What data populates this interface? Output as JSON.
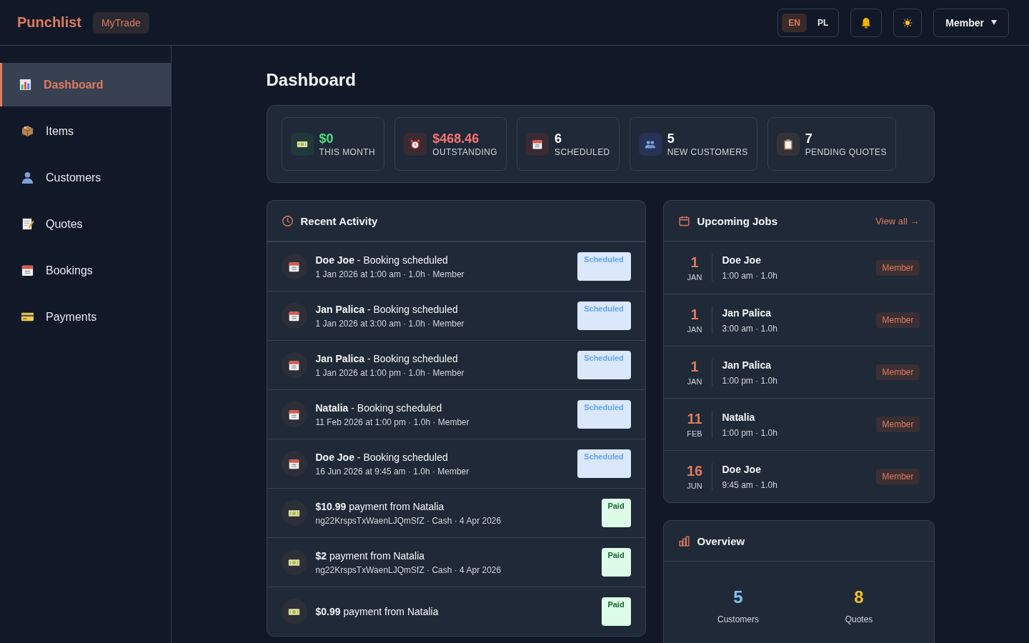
{
  "brand": {
    "name": "Punchlist",
    "tag": "MyTrade"
  },
  "languages": [
    {
      "label": "EN",
      "selected": true
    },
    {
      "label": "PL",
      "selected": false
    }
  ],
  "user_menu": {
    "label": "Member"
  },
  "sidebar": {
    "items": [
      {
        "label": "Dashboard",
        "selected": true
      },
      {
        "label": "Items",
        "selected": false
      },
      {
        "label": "Customers",
        "selected": false
      },
      {
        "label": "Quotes",
        "selected": false
      },
      {
        "label": "Bookings",
        "selected": false
      },
      {
        "label": "Payments",
        "selected": false
      }
    ]
  },
  "page_title": "Dashboard",
  "stats": [
    {
      "kind": "revenue",
      "value": "$0",
      "label": "THIS MONTH"
    },
    {
      "kind": "outstanding",
      "value": "$468.46",
      "label": "OUTSTANDING"
    },
    {
      "kind": "scheduled",
      "value": "6",
      "label": "SCHEDULED"
    },
    {
      "kind": "customers",
      "value": "5",
      "label": "NEW CUSTOMERS"
    },
    {
      "kind": "quotes",
      "value": "7",
      "label": "PENDING QUOTES"
    }
  ],
  "recent_activity": {
    "title": "Recent Activity",
    "items": [
      {
        "kind": "booking",
        "title": "**Doe Joe** - Booking scheduled",
        "detail": "1 Jan 2026 at 1:00 am · 1.0h · Member",
        "status": "Scheduled"
      },
      {
        "kind": "booking",
        "title": "**Jan Palica** - Booking scheduled",
        "detail": "1 Jan 2026 at 3:00 am · 1.0h · Member",
        "status": "Scheduled"
      },
      {
        "kind": "booking",
        "title": "**Jan Palica** - Booking scheduled",
        "detail": "1 Jan 2026 at 1:00 pm · 1.0h · Member",
        "status": "Scheduled"
      },
      {
        "kind": "booking",
        "title": "**Natalia** - Booking scheduled",
        "detail": "11 Feb 2026 at 1:00 pm · 1.0h · Member",
        "status": "Scheduled"
      },
      {
        "kind": "booking",
        "title": "**Doe Joe** - Booking scheduled",
        "detail": "16 Jun 2026 at 9:45 am · 1.0h · Member",
        "status": "Scheduled"
      },
      {
        "kind": "payment",
        "title": "**$10.99** payment from Natalia",
        "detail": "ng22KrspsTxWaenLJQmSfZ · Cash · 4 Apr 2026",
        "status": "Paid"
      },
      {
        "kind": "payment",
        "title": "**$2** payment from Natalia",
        "detail": "ng22KrspsTxWaenLJQmSfZ · Cash · 4 Apr 2026",
        "status": "Paid"
      },
      {
        "kind": "payment",
        "title": "**$0.99** payment from Natalia",
        "status": "Paid"
      }
    ]
  },
  "upcoming_jobs": {
    "title": "Upcoming Jobs",
    "link": "View all →",
    "items": [
      {
        "day": "1",
        "month": "JAN",
        "name": "Doe Joe",
        "detail": "1:00 am · 1.0h",
        "tag": "Member"
      },
      {
        "day": "1",
        "month": "JAN",
        "name": "Jan Palica",
        "detail": "3:00 am · 1.0h",
        "tag": "Member"
      },
      {
        "day": "1",
        "month": "JAN",
        "name": "Jan Palica",
        "detail": "1:00 pm · 1.0h",
        "tag": "Member"
      },
      {
        "day": "11",
        "month": "FEB",
        "name": "Natalia",
        "detail": "1:00 pm · 1.0h",
        "tag": "Member"
      },
      {
        "day": "16",
        "month": "JUN",
        "name": "Doe Joe",
        "detail": "9:45 am · 1.0h",
        "tag": "Member"
      }
    ]
  },
  "overview": {
    "title": "Overview",
    "items": [
      {
        "kind": "customers",
        "value": "5",
        "label": "Customers"
      },
      {
        "kind": "quotes",
        "value": "8",
        "label": "Quotes"
      }
    ]
  }
}
